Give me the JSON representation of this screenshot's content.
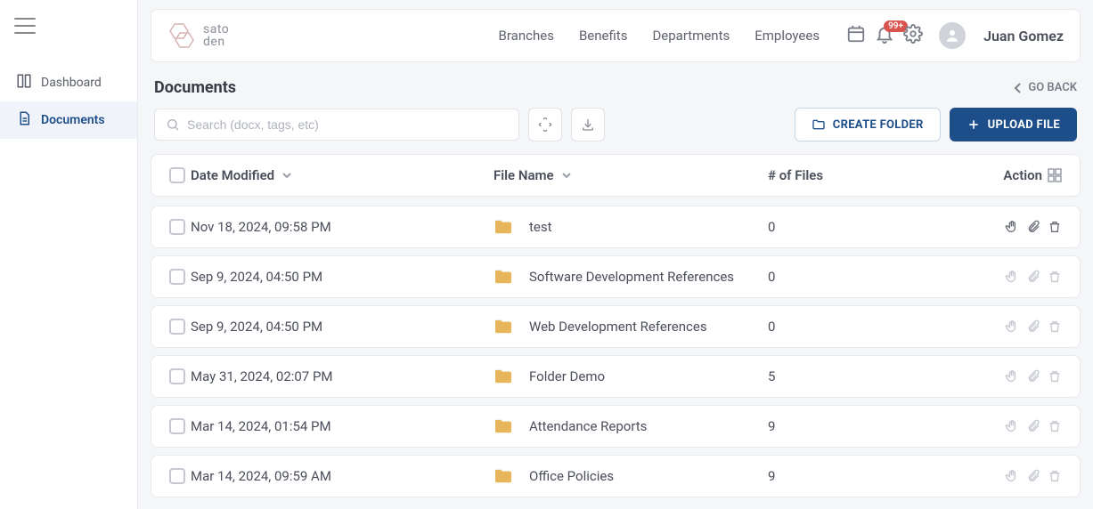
{
  "brand": {
    "name1": "sato",
    "name2": "den"
  },
  "nav": [
    "Branches",
    "Benefits",
    "Departments",
    "Employees"
  ],
  "notifications": {
    "badge": "99+"
  },
  "user": {
    "name": "Juan Gomez"
  },
  "sidebar": {
    "items": [
      {
        "label": "Dashboard",
        "icon": "dashboard",
        "active": false
      },
      {
        "label": "Documents",
        "icon": "document",
        "active": true
      }
    ]
  },
  "page": {
    "title": "Documents",
    "goback": "GO BACK"
  },
  "toolbar": {
    "search_placeholder": "Search (docx, tags, etc)",
    "create_folder": "CREATE FOLDER",
    "upload_file": "UPLOAD FILE"
  },
  "table": {
    "headers": {
      "date": "Date Modified",
      "name": "File Name",
      "files": "# of Files",
      "action": "Action"
    },
    "rows": [
      {
        "date": "Nov 18, 2024, 09:58 PM",
        "name": "test",
        "files": "0",
        "active_actions": true
      },
      {
        "date": "Sep 9, 2024, 04:50 PM",
        "name": "Software Development References",
        "files": "0",
        "active_actions": false
      },
      {
        "date": "Sep 9, 2024, 04:50 PM",
        "name": "Web Development References",
        "files": "0",
        "active_actions": false
      },
      {
        "date": "May 31, 2024, 02:07 PM",
        "name": "Folder Demo",
        "files": "5",
        "active_actions": false
      },
      {
        "date": "Mar 14, 2024, 01:54 PM",
        "name": "Attendance Reports",
        "files": "9",
        "active_actions": false
      },
      {
        "date": "Mar 14, 2024, 09:59 AM",
        "name": "Office Policies",
        "files": "9",
        "active_actions": false
      }
    ]
  }
}
